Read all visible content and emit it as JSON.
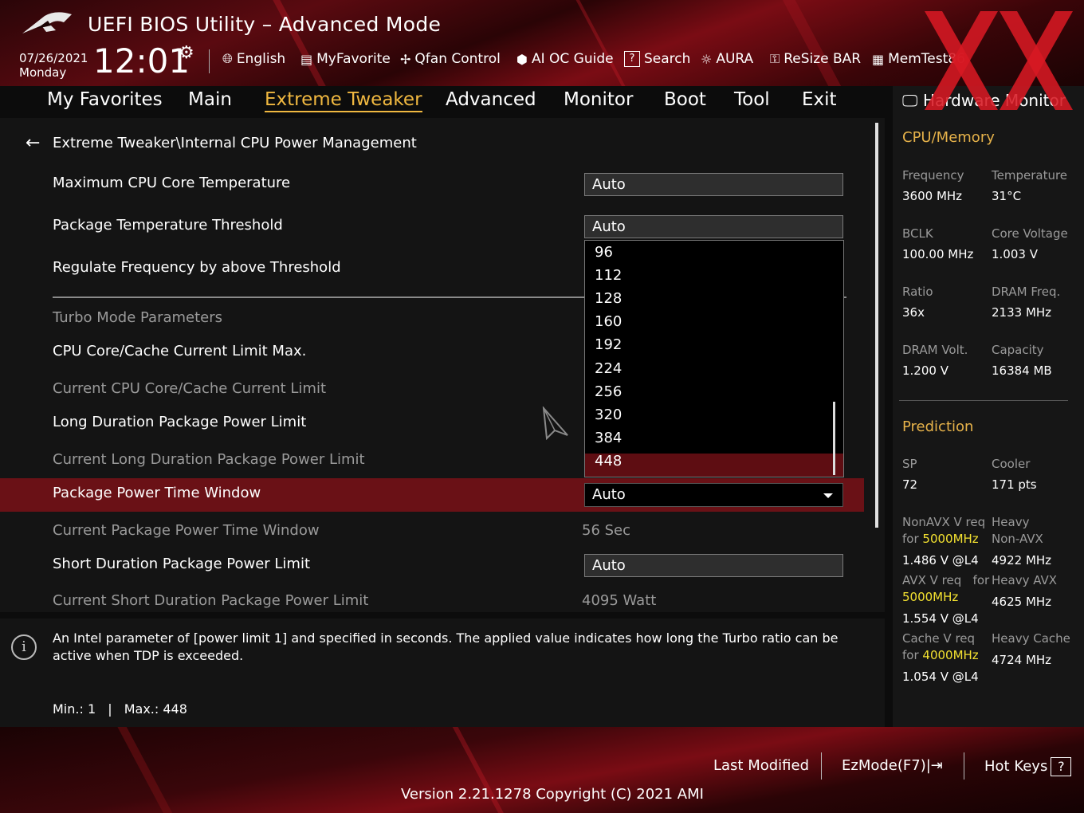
{
  "header": {
    "title": "UEFI BIOS Utility – Advanced Mode",
    "date": "07/26/2021",
    "day": "Monday",
    "time": "12:01",
    "tools": [
      {
        "label": "English",
        "icon": "globe-icon"
      },
      {
        "label": "MyFavorite",
        "icon": "favorite-icon"
      },
      {
        "label": "Qfan Control",
        "icon": "fan-icon"
      },
      {
        "label": "AI OC Guide",
        "icon": "ai-guide-icon"
      },
      {
        "label": "Search",
        "icon": "search-icon"
      },
      {
        "label": "AURA",
        "icon": "aura-icon"
      },
      {
        "label": "ReSize BAR",
        "icon": "resize-bar-icon"
      },
      {
        "label": "MemTest86",
        "icon": "memtest-icon"
      }
    ]
  },
  "menu": {
    "tabs": [
      "My Favorites",
      "Main",
      "Extreme Tweaker",
      "Advanced",
      "Monitor",
      "Boot",
      "Tool",
      "Exit"
    ],
    "active": "Extreme Tweaker"
  },
  "content": {
    "breadcrumb": "Extreme Tweaker\\Internal CPU Power Management",
    "rows": [
      {
        "label": "Maximum CPU Core Temperature",
        "value": "Auto"
      },
      {
        "label": "Package Temperature Threshold",
        "value": "Auto"
      },
      {
        "label": "Regulate Frequency by above Threshold"
      },
      {
        "label": "Turbo Mode Parameters"
      },
      {
        "label": "CPU Core/Cache Current Limit Max."
      },
      {
        "label": "Current CPU Core/Cache Current Limit"
      },
      {
        "label": "Long Duration Package Power Limit"
      },
      {
        "label": "Current Long Duration Package Power Limit"
      },
      {
        "label": "Package Power Time Window",
        "value": "Auto"
      },
      {
        "label": "Current Package Power Time Window",
        "value": "56 Sec"
      },
      {
        "label": "Short Duration Package Power Limit",
        "value": "Auto"
      },
      {
        "label": "Current Short Duration Package Power Limit",
        "value": "4095 Watt"
      }
    ],
    "dropdown_options": [
      "96",
      "112",
      "128",
      "160",
      "192",
      "224",
      "256",
      "320",
      "384",
      "448"
    ],
    "dropdown_selected": "448"
  },
  "help": {
    "text": "An Intel parameter of [power limit 1] and specified in seconds. The applied value indicates how long the Turbo ratio can be active when TDP is exceeded.",
    "min": "Min.: 1",
    "sep": "|",
    "max": "Max.: 448"
  },
  "hardware_monitor": {
    "title": "Hardware Monitor",
    "cpu_memory": {
      "heading": "CPU/Memory",
      "items": [
        {
          "k": "Frequency",
          "v": "3600 MHz"
        },
        {
          "k": "Temperature",
          "v": "31°C"
        },
        {
          "k": "BCLK",
          "v": "100.00 MHz"
        },
        {
          "k": "Core Voltage",
          "v": "1.003 V"
        },
        {
          "k": "Ratio",
          "v": "36x"
        },
        {
          "k": "DRAM Freq.",
          "v": "2133 MHz"
        },
        {
          "k": "DRAM Volt.",
          "v": "1.200 V"
        },
        {
          "k": "Capacity",
          "v": "16384 MB"
        }
      ]
    },
    "prediction": {
      "heading": "Prediction",
      "sp_k": "SP",
      "sp_v": "72",
      "cooler_k": "Cooler",
      "cooler_v": "171 pts",
      "nonavx_k1": "NonAVX V req",
      "nonavx_for": "for",
      "nonavx_freq": "5000MHz",
      "nonavx_v": "1.486 V @L4",
      "heavy_nonavx_k1": "Heavy",
      "heavy_nonavx_k2": "Non-AVX",
      "heavy_nonavx_v": "4922 MHz",
      "avx_k1": "AVX V req",
      "avx_for": "for",
      "avx_freq": "5000MHz",
      "avx_v": "1.554 V @L4",
      "heavy_avx_k": "Heavy AVX",
      "heavy_avx_v": "4625 MHz",
      "cache_k1": "Cache V req",
      "cache_for": "for",
      "cache_freq": "4000MHz",
      "cache_v": "1.054 V @L4",
      "heavy_cache_k": "Heavy Cache",
      "heavy_cache_v": "4724 MHz"
    }
  },
  "footer": {
    "last_modified": "Last Modified",
    "ezmode": "EzMode(F7)|",
    "hotkeys": "Hot Keys",
    "hotkeys_box": "?",
    "version": "Version 2.21.1278 Copyright (C) 2021 AMI"
  },
  "colors": {
    "accent": "#f0b840",
    "highlight_row": "#6a1116",
    "prediction_freq": "#f4e230"
  }
}
